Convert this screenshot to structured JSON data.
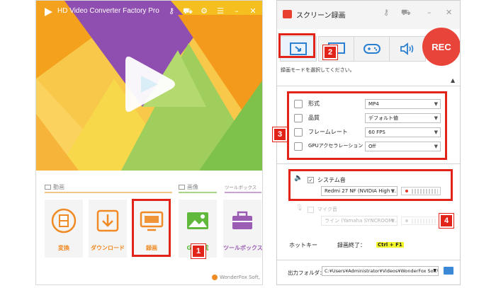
{
  "left_window": {
    "title": "HD Video Converter Factory Pro",
    "titlebar_icons": [
      "key-icon",
      "cart-icon",
      "gear-icon",
      "menu-icon",
      "minimize-icon",
      "close-icon"
    ],
    "sections": {
      "video": "動画",
      "image": "画像",
      "toolbox": "ツールボックス"
    },
    "tools": [
      {
        "label": "変換",
        "icon": "film-icon",
        "color": "#f08a24"
      },
      {
        "label": "ダウンロード",
        "icon": "download-icon",
        "color": "#f08a24"
      },
      {
        "label": "録画",
        "icon": "screen-record-icon",
        "color": "#f08a24"
      },
      {
        "label": "GIF作成",
        "icon": "image-icon",
        "color": "#61b93b"
      },
      {
        "label": "ツールボックス",
        "icon": "toolbox-icon",
        "color": "#9a5db3"
      }
    ],
    "footer": "WonderFox Soft, Inc."
  },
  "right_window": {
    "title": "スクリーン録画",
    "titlebar_icons": [
      "key-icon",
      "cart-icon",
      "minimize-icon",
      "close-icon"
    ],
    "modes": [
      "region-capture-icon",
      "fullscreen-icon",
      "game-icon",
      "audio-icon"
    ],
    "rec_label": "REC",
    "hint": "録画モードを選択してください。",
    "settings": [
      {
        "label": "形式",
        "value": "MP4"
      },
      {
        "label": "品質",
        "value": "デフォルト値"
      },
      {
        "label": "フレームレート",
        "value": "60 FPS"
      },
      {
        "label": "GPUアクセラレーション",
        "value": "Off"
      }
    ],
    "system_audio": {
      "label": "システム音",
      "checked": true,
      "device": "Redmi 27 NF (NVIDIA High ..."
    },
    "mic": {
      "label": "マイク音",
      "checked": false,
      "device": "ライン (Yamaha SYNCROOM..."
    },
    "hotkey": {
      "label": "ホットキー",
      "stop_label": "録画終了：",
      "stop_value": "Ctrl + F1"
    },
    "output": {
      "label": "出力フォルダ：",
      "path": "C:¥Users¥Administrator¥Videos¥WonderFox Soft¥HD V"
    }
  },
  "callouts": [
    "1",
    "2",
    "3",
    "4"
  ],
  "colors": {
    "accent_red": "#e2231a",
    "rec_red": "#e9443a",
    "orange": "#f08a24",
    "green": "#61b93b",
    "purple": "#9a5db3",
    "highlight_yellow": "#f3f62a"
  }
}
